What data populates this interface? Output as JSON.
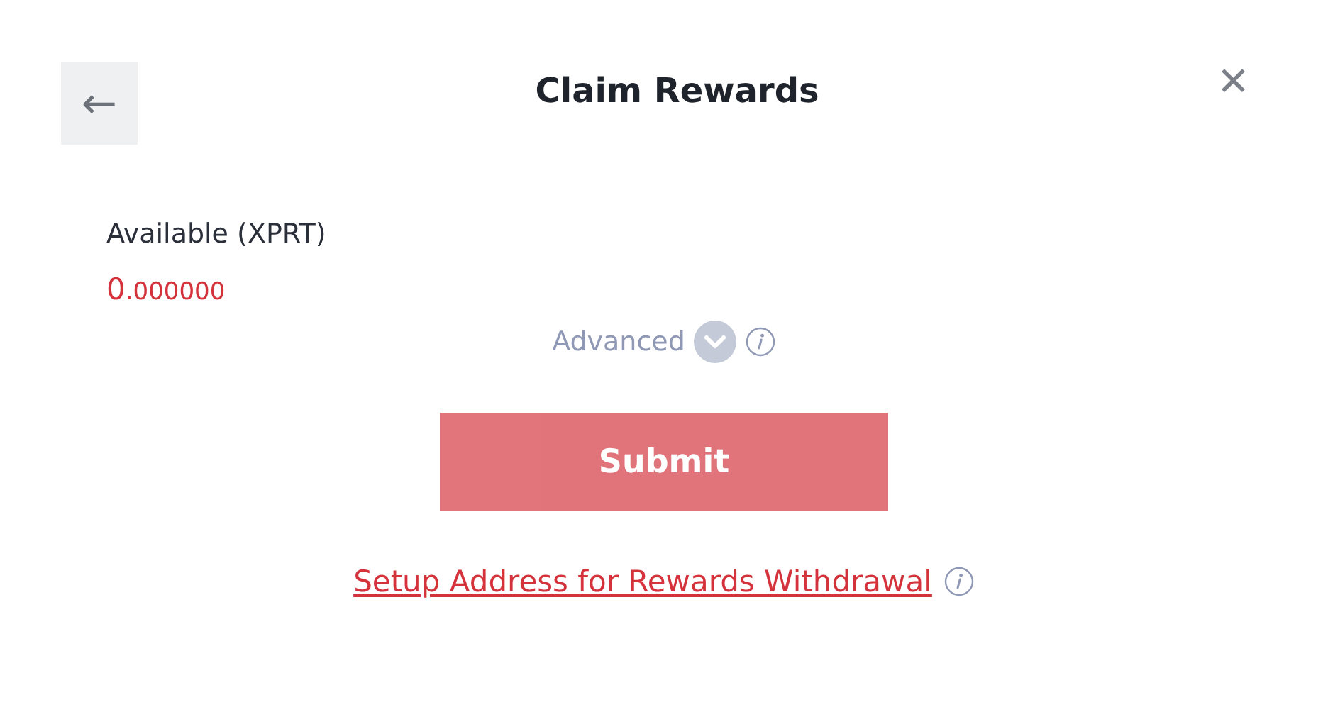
{
  "dialog": {
    "title": "Claim Rewards",
    "back_button": "←",
    "close_button": "✕"
  },
  "available": {
    "label": "Available (XPRT)",
    "amount_integer": "0",
    "amount_fraction": ".000000"
  },
  "advanced": {
    "label": "Advanced",
    "expanded": false
  },
  "submit": {
    "label": "Submit",
    "disabled": true
  },
  "withdraw_link": {
    "label": "Setup Address for Rewards Withdrawal"
  }
}
